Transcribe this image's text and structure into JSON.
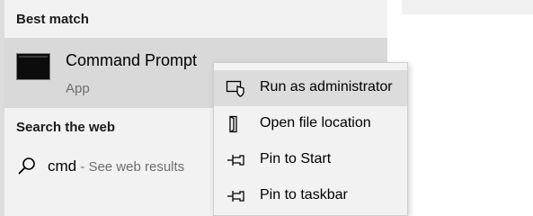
{
  "best_match": {
    "header": "Best match",
    "app_name": "Command Prompt",
    "app_type": "App",
    "icon": "command-prompt-icon"
  },
  "web": {
    "header": "Search the web",
    "query": "cmd",
    "suffix": " - See web results",
    "icon": "search-icon"
  },
  "context_menu": {
    "items": [
      {
        "label": "Run as administrator",
        "icon": "shield-icon",
        "highlighted": true
      },
      {
        "label": "Open file location",
        "icon": "file-location-icon",
        "highlighted": false
      },
      {
        "label": "Pin to Start",
        "icon": "pin-icon",
        "highlighted": false
      },
      {
        "label": "Pin to taskbar",
        "icon": "pin-icon",
        "highlighted": false
      }
    ]
  },
  "colors": {
    "panel_bg": "#f2f2f2",
    "selected_bg": "#d9d9d9",
    "menu_highlight": "#dcdcdc",
    "secondary_text": "#6e6e6e"
  }
}
